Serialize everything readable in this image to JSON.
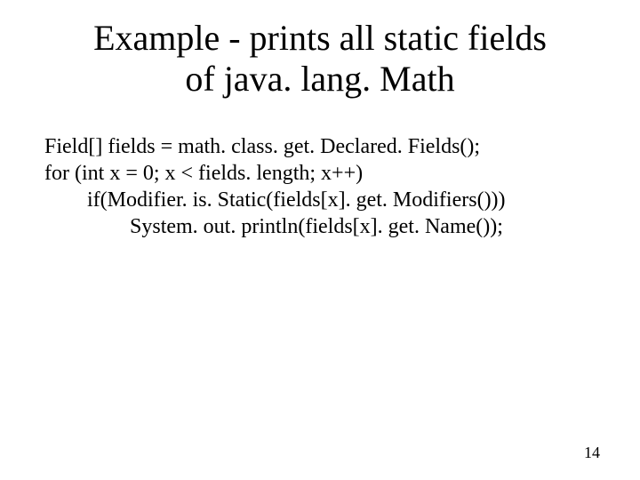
{
  "title_line1": "Example - prints all static fields",
  "title_line2": "of java. lang. Math",
  "code": {
    "l1": "Field[] fields = math. class. get. Declared. Fields();",
    "l2": "for (int x = 0; x < fields. length; x++)",
    "l3": "        if(Modifier. is. Static(fields[x]. get. Modifiers()))",
    "l4": "                System. out. println(fields[x]. get. Name());"
  },
  "page_number": "14"
}
